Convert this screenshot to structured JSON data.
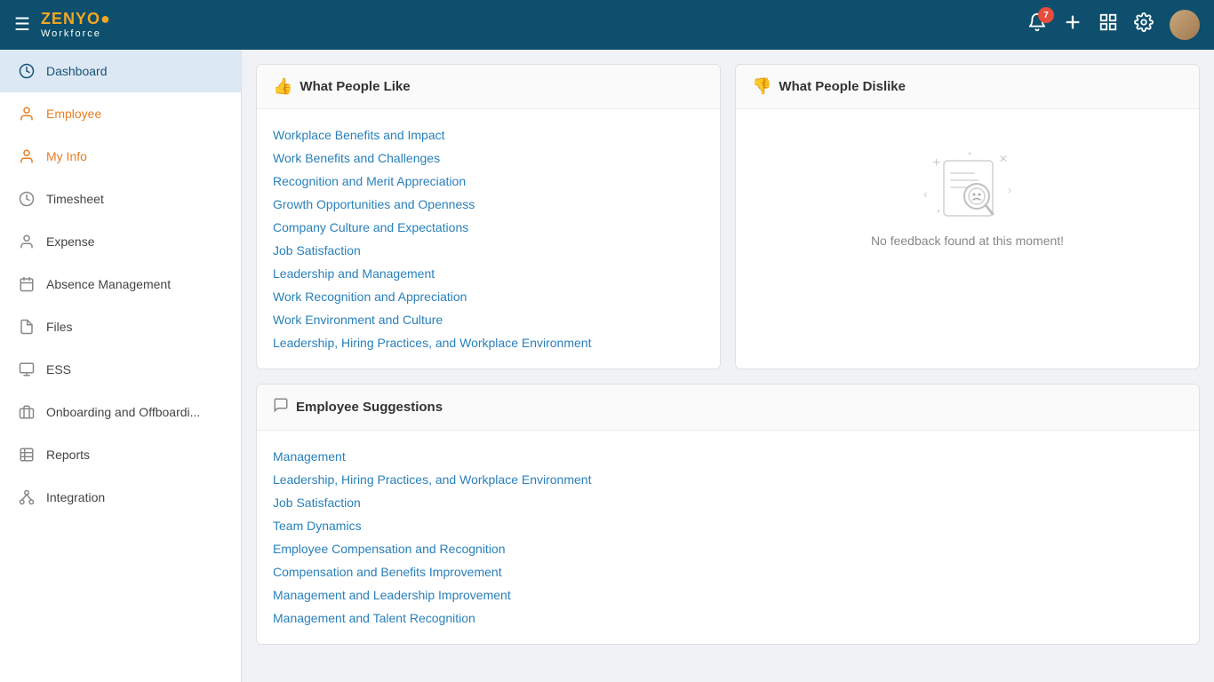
{
  "topnav": {
    "logo_zenyo": "ZENYO",
    "logo_dot": "●",
    "logo_workforce": "Workforce",
    "notification_count": "7",
    "icons": {
      "hamburger": "☰",
      "bell": "🔔",
      "plus": "+",
      "grid": "⊞",
      "gear": "⚙"
    }
  },
  "sidebar": {
    "items": [
      {
        "id": "dashboard",
        "label": "Dashboard",
        "active": true
      },
      {
        "id": "employee",
        "label": "Employee",
        "active": false
      },
      {
        "id": "myinfo",
        "label": "My Info",
        "active": false
      },
      {
        "id": "timesheet",
        "label": "Timesheet",
        "active": false
      },
      {
        "id": "expense",
        "label": "Expense",
        "active": false
      },
      {
        "id": "absence",
        "label": "Absence Management",
        "active": false
      },
      {
        "id": "files",
        "label": "Files",
        "active": false
      },
      {
        "id": "ess",
        "label": "ESS",
        "active": false
      },
      {
        "id": "onboarding",
        "label": "Onboarding and Offboardi...",
        "active": false
      },
      {
        "id": "reports",
        "label": "Reports",
        "active": false
      },
      {
        "id": "integration",
        "label": "Integration",
        "active": false
      }
    ]
  },
  "what_people_like": {
    "title": "What People Like",
    "items": [
      "Workplace Benefits and Impact",
      "Work Benefits and Challenges",
      "Recognition and Merit Appreciation",
      "Growth Opportunities and Openness",
      "Company Culture and Expectations",
      "Job Satisfaction",
      "Leadership and Management",
      "Work Recognition and Appreciation",
      "Work Environment and Culture",
      "Leadership, Hiring Practices, and Workplace Environment"
    ]
  },
  "what_people_dislike": {
    "title": "What People Dislike",
    "empty_text": "No feedback found at this moment!"
  },
  "employee_suggestions": {
    "title": "Employee Suggestions",
    "items": [
      "Management",
      "Leadership, Hiring Practices, and Workplace Environment",
      "Job Satisfaction",
      "Team Dynamics",
      "Employee Compensation and Recognition",
      "Compensation and Benefits Improvement",
      "Management and Leadership Improvement",
      "Management and Talent Recognition"
    ]
  }
}
